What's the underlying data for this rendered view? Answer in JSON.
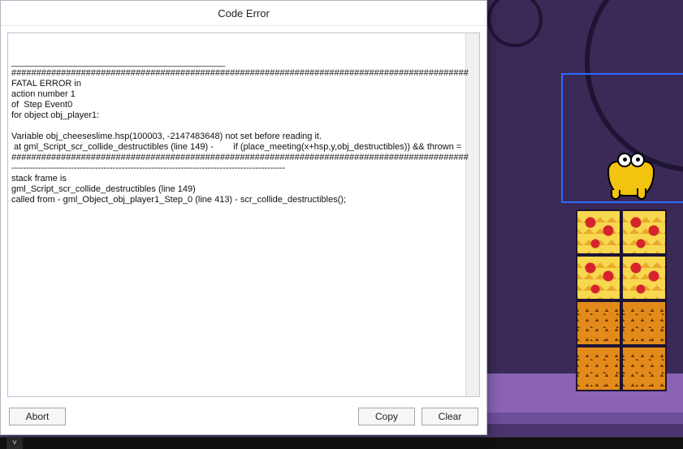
{
  "dialog": {
    "title": "Code Error",
    "abort_label": "Abort",
    "copy_label": "Copy",
    "clear_label": "Clear",
    "error_text": "___________________________________________\n############################################################################################\nFATAL ERROR in\naction number 1\nof  Step Event0\nfor object obj_player1:\n\nVariable obj_cheeseslime.hsp(100003, -2147483648) not set before reading it.\n at gml_Script_scr_collide_destructibles (line 149) -        if (place_meeting(x+hsp,y,obj_destructibles)) && thrown =\n############################################################################################\n--------------------------------------------------------------------------------------------\nstack frame is\ngml_Script_scr_collide_destructibles (line 149)\ncalled from - gml_Object_obj_player1_Step_0 (line 413) - scr_collide_destructibles();"
  },
  "scene": {
    "selected_object": "obj_cheeseslime",
    "tile_kinds": [
      "cheese",
      "cheese",
      "cheese",
      "cheese",
      "crack",
      "crack",
      "crack",
      "crack"
    ]
  },
  "colors": {
    "bg_dark": "#3b2a57",
    "bg_band": "#8a63b5",
    "selection": "#2a6cff",
    "cheese": "#f7d84f",
    "crack": "#e38b1a"
  }
}
